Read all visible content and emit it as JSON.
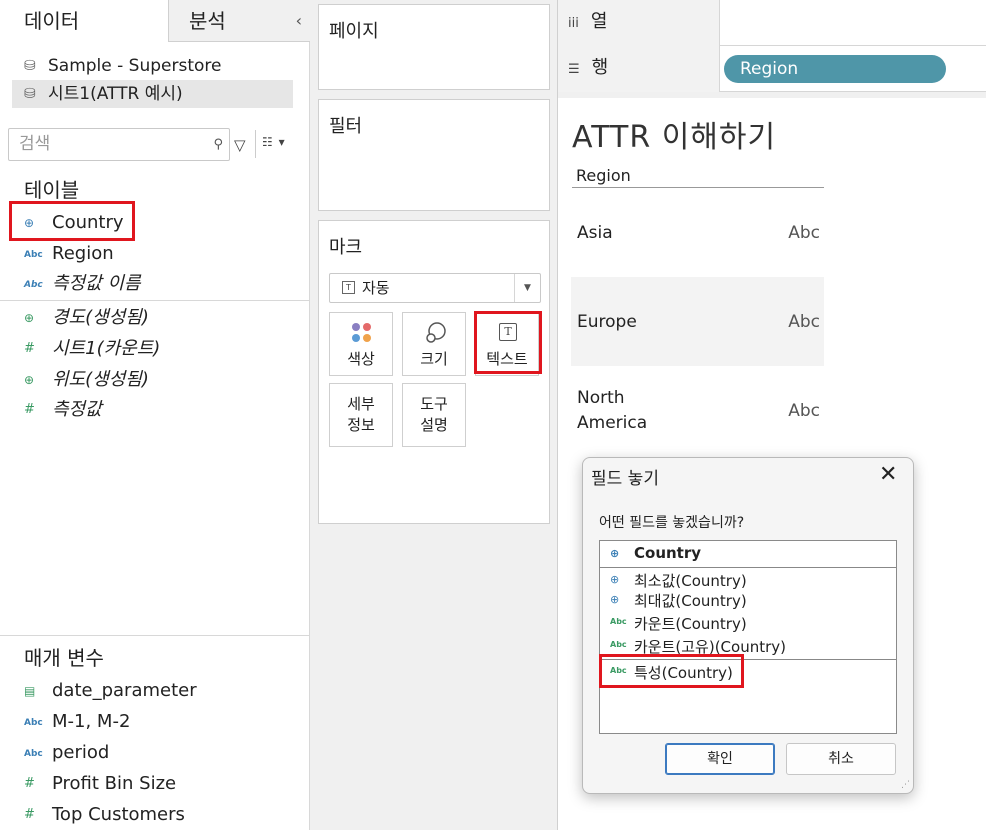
{
  "left": {
    "tabs": {
      "data": "데이터",
      "analysis": "분석",
      "collapse": "‹"
    },
    "datasources": [
      "Sample - Superstore",
      "시트1(ATTR  예시)"
    ],
    "search_placeholder": "검색",
    "tables_title": "테이블",
    "dimensions": [
      {
        "name": "Country",
        "icon": "globe-icon"
      },
      {
        "name": "Region",
        "icon": "abc-icon"
      },
      {
        "name": "측정값 이름",
        "icon": "abc-icon"
      }
    ],
    "measures": [
      {
        "name": "경도(생성됨)",
        "icon": "globe-icon"
      },
      {
        "name": "시트1(카운트)",
        "icon": "hash-icon"
      },
      {
        "name": "위도(생성됨)",
        "icon": "globe-icon"
      },
      {
        "name": "측정값",
        "icon": "hash-icon"
      }
    ],
    "parameters_title": "매개 변수",
    "parameters": [
      {
        "name": "date_parameter",
        "icon": "calendar-icon"
      },
      {
        "name": "M-1, M-2",
        "icon": "abc-icon"
      },
      {
        "name": "period",
        "icon": "abc-icon"
      },
      {
        "name": "Profit Bin Size",
        "icon": "hash-icon"
      },
      {
        "name": "Top Customers",
        "icon": "hash-icon"
      }
    ]
  },
  "middle": {
    "pages_title": "페이지",
    "filters_title": "필터",
    "marks_title": "마크",
    "mark_type": "자동",
    "mark_buttons": {
      "color": "색상",
      "size": "크기",
      "text": "텍스트",
      "detail_1": "세부",
      "detail_2": "정보",
      "tooltip_1": "도구",
      "tooltip_2": "설명"
    }
  },
  "shelves": {
    "columns_label": "열",
    "rows_label": "행",
    "rows_pill": "Region"
  },
  "viz": {
    "title": "ATTR 이해하기",
    "column_header": "Region",
    "rows": [
      {
        "label_1": "Asia",
        "label_2": "",
        "value": "Abc"
      },
      {
        "label_1": "Europe",
        "label_2": "",
        "value": "Abc"
      },
      {
        "label_1": "North",
        "label_2": "America",
        "value": "Abc"
      }
    ]
  },
  "dialog": {
    "title": "필드 놓기",
    "prompt": "어떤 필드를 놓겠습니까?",
    "options": [
      {
        "label": "Country",
        "icon": "globe-icon"
      },
      {
        "label": "최소값(Country)",
        "icon": "globe-icon"
      },
      {
        "label": "최대값(Country)",
        "icon": "globe-icon"
      },
      {
        "label": "카운트(Country)",
        "icon": "abc-icon"
      },
      {
        "label": "카운트(고유)(Country)",
        "icon": "abc-icon"
      },
      {
        "label": "특성(Country)",
        "icon": "abc-icon"
      }
    ],
    "ok": "확인",
    "cancel": "취소"
  }
}
